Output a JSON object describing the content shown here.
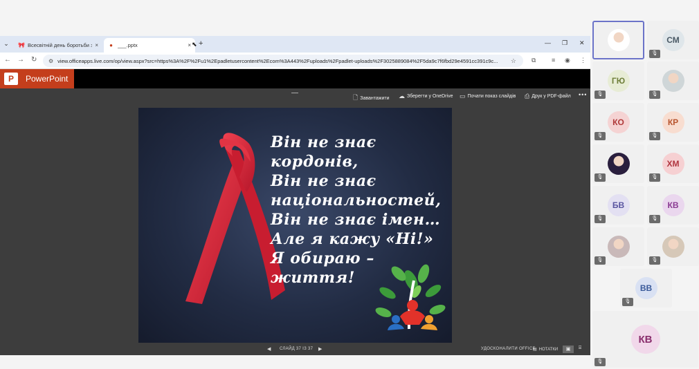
{
  "browser": {
    "tab_menu_icon": "chevron-down-icon",
    "tabs": [
      {
        "label": "Всесвітній день боротьби зі С",
        "favicon": "ribbon-favicon",
        "active": false
      },
      {
        "label": "___.pptx",
        "favicon": "powerpoint-favicon",
        "active": true
      }
    ],
    "new_tab": "+",
    "close": "×",
    "window_controls": {
      "minimize": "—",
      "maximize": "❐",
      "close": "✕"
    },
    "url": "view.officeapps.live.com/op/view.aspx?src=https%3A%2F%2Fu1%2Epadletusercontent%2Ecom%3A443%2Fuploads%2Fpadlet-uploads%2F3025889084%2F5da9c7f6fbd29e4591cc391c9c..."
  },
  "powerpoint": {
    "app_name": "PowerPoint",
    "logo_letter": "P",
    "toolbar": {
      "download": "Завантажити",
      "save_onedrive": "Зберегти у OneDrive",
      "start_slideshow": "Почати показ слайдів",
      "print_pdf": "Друк у PDF-файл",
      "more": "•••"
    },
    "slide": {
      "lines": [
        "Він не знає",
        "кордонів,",
        "Він не знає",
        "національностей,",
        "Він не знає імен…",
        "Але я кажу «Ні!»",
        "Я обираю –",
        "життя!"
      ],
      "text_color": "#ffffff",
      "ribbon_color": "#d8232f",
      "background_color": "#222c44"
    },
    "status": {
      "prev": "◀",
      "next": "▶",
      "slide_counter": "СЛАЙД 37 ІЗ 37",
      "improve": "УДОСКОНАЛИТИ OFFICE",
      "notes": "НОТАТКИ"
    },
    "brand_color": "#c43e1c"
  },
  "participants": [
    {
      "initials": "",
      "photo": true,
      "active": true,
      "muted": false,
      "bg": "#ffffff",
      "color": "#333"
    },
    {
      "initials": "СМ",
      "photo": false,
      "muted": true,
      "bg": "#dfe6ea",
      "color": "#4a5a66"
    },
    {
      "initials": "ГЮ",
      "photo": false,
      "muted": true,
      "bg": "#e7ecd5",
      "color": "#6f7f3a"
    },
    {
      "initials": "",
      "photo": true,
      "muted": true,
      "bg": "#cfd6d8",
      "color": "#333"
    },
    {
      "initials": "КО",
      "photo": false,
      "muted": true,
      "bg": "#f5d3d3",
      "color": "#b03a3a"
    },
    {
      "initials": "КР",
      "photo": false,
      "muted": true,
      "bg": "#f8ddd0",
      "color": "#b8552e"
    },
    {
      "initials": "",
      "photo": true,
      "muted": true,
      "bg": "#2a1f3e",
      "color": "#333"
    },
    {
      "initials": "ХМ",
      "photo": false,
      "muted": true,
      "bg": "#f6d0d2",
      "color": "#b0353f"
    },
    {
      "initials": "БВ",
      "photo": false,
      "muted": true,
      "bg": "#e3e0f2",
      "color": "#5a55a0"
    },
    {
      "initials": "КВ",
      "photo": false,
      "muted": true,
      "bg": "#ead7ee",
      "color": "#8a3a92"
    },
    {
      "initials": "",
      "photo": true,
      "muted": true,
      "bg": "#c9b9b9",
      "color": "#333"
    },
    {
      "initials": "",
      "photo": true,
      "muted": true,
      "bg": "#d6c8b8",
      "color": "#333"
    },
    {
      "initials": "ВВ",
      "photo": false,
      "muted": true,
      "bg": "#d9e1f3",
      "color": "#3a5a9a"
    },
    {
      "initials": "КВ",
      "photo": false,
      "muted": true,
      "bg": "#f1d8ea",
      "color": "#8a2f6e"
    }
  ],
  "mute_icon": "mic-off-icon"
}
